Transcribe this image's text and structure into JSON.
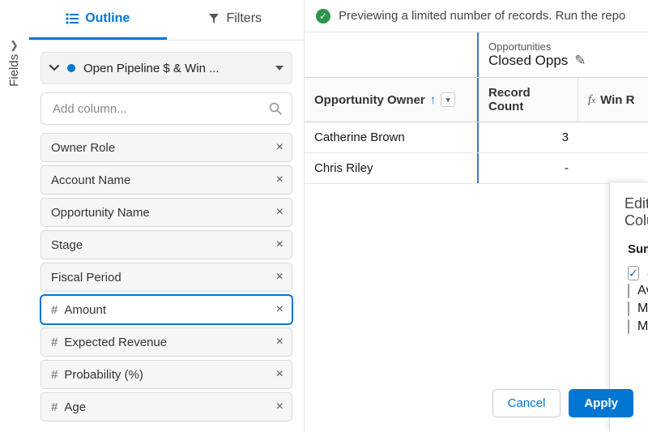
{
  "fields_rail": {
    "label": "Fields"
  },
  "tabs": {
    "outline": "Outline",
    "filters": "Filters"
  },
  "report_select": {
    "label": "Open Pipeline $ & Win ..."
  },
  "search": {
    "placeholder": "Add column..."
  },
  "columns": [
    {
      "label": "Owner Role",
      "numeric": false,
      "selected": false
    },
    {
      "label": "Account Name",
      "numeric": false,
      "selected": false
    },
    {
      "label": "Opportunity Name",
      "numeric": false,
      "selected": false
    },
    {
      "label": "Stage",
      "numeric": false,
      "selected": false
    },
    {
      "label": "Fiscal Period",
      "numeric": false,
      "selected": false
    },
    {
      "label": "Amount",
      "numeric": true,
      "selected": true
    },
    {
      "label": "Expected Revenue",
      "numeric": true,
      "selected": false
    },
    {
      "label": "Probability (%)",
      "numeric": true,
      "selected": false
    },
    {
      "label": "Age",
      "numeric": true,
      "selected": false
    }
  ],
  "banner": {
    "text": "Previewing a limited number of records. Run the repo"
  },
  "grid": {
    "group": {
      "top": "Opportunities",
      "title": "Closed Opps"
    },
    "headers": {
      "owner": "Opportunity Owner",
      "count": "Record Count",
      "winrate": "Win R"
    },
    "rows": [
      {
        "owner": "Catherine Brown",
        "count": "3"
      },
      {
        "owner": "Chris Riley",
        "count": "-"
      }
    ]
  },
  "popover": {
    "title": "Edit Column",
    "section": "Summarize",
    "options": [
      {
        "label": "Sum",
        "checked": true
      },
      {
        "label": "Average",
        "checked": false
      },
      {
        "label": "Max",
        "checked": false
      },
      {
        "label": "Min",
        "checked": false
      }
    ],
    "cancel": "Cancel",
    "apply": "Apply"
  },
  "icons": {
    "hash": "#",
    "remove": "×",
    "check": "✓",
    "pencil": "✎",
    "arrow_up": "↑",
    "caret_down": "▾"
  }
}
